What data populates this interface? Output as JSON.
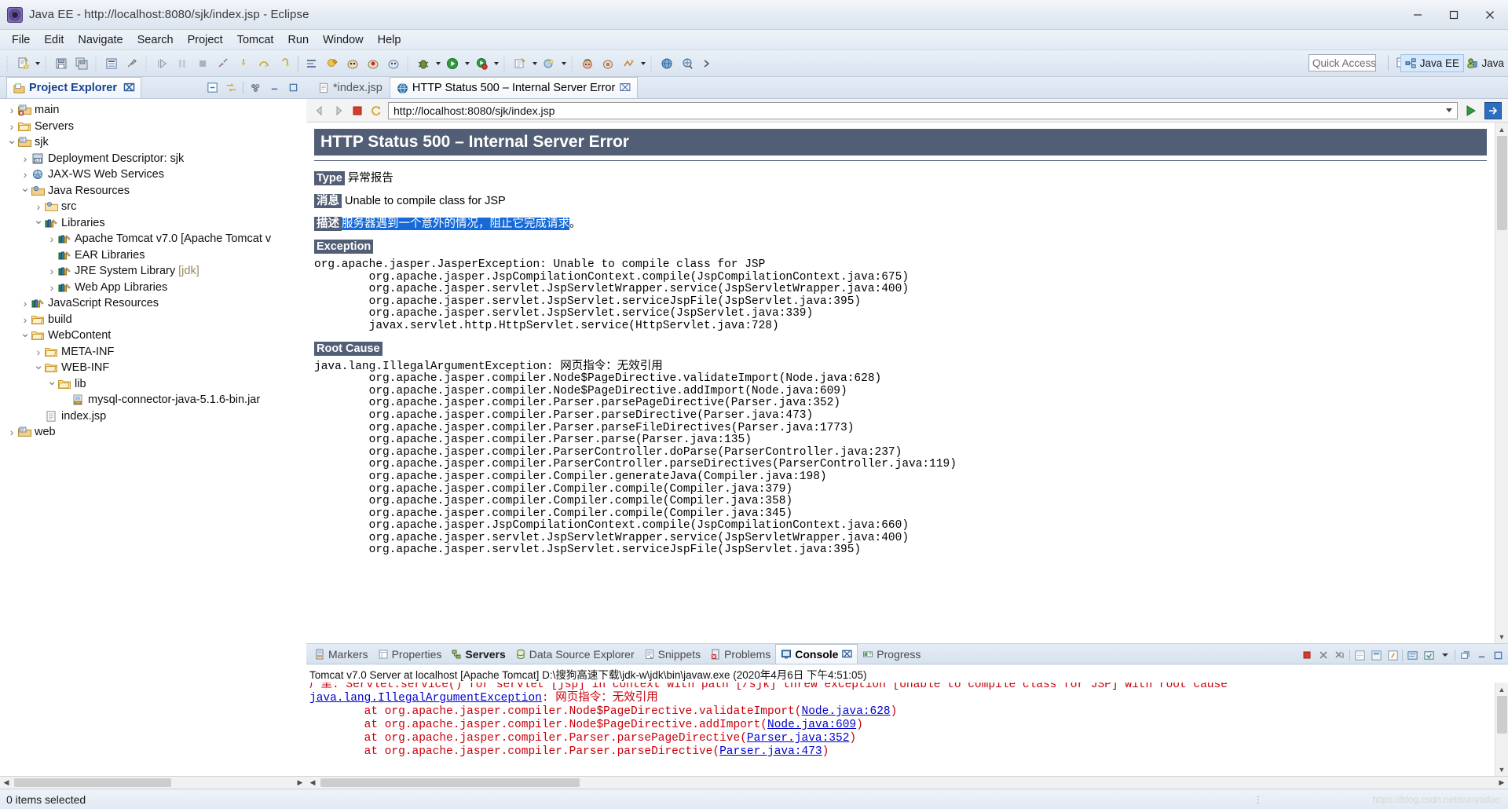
{
  "window": {
    "title": "Java EE - http://localhost:8080/sjk/index.jsp - Eclipse",
    "minimize": "─",
    "maximize": "❐",
    "close": "✕"
  },
  "menubar": {
    "items": [
      "File",
      "Edit",
      "Navigate",
      "Search",
      "Project",
      "Tomcat",
      "Run",
      "Window",
      "Help"
    ]
  },
  "toolbar": {
    "quick_access_placeholder": "Quick Access",
    "perspective_active": "Java EE",
    "perspective_other": "Java"
  },
  "project_explorer": {
    "title": "Project Explorer",
    "close_glyph": "⌧",
    "tree": [
      {
        "indent": 0,
        "twisty": "collapsed",
        "icon": "project-error-icon",
        "label": "main"
      },
      {
        "indent": 0,
        "twisty": "collapsed",
        "icon": "folder-icon",
        "label": "Servers"
      },
      {
        "indent": 0,
        "twisty": "expanded",
        "icon": "project-icon",
        "label": "sjk"
      },
      {
        "indent": 1,
        "twisty": "collapsed",
        "icon": "deployment-descriptor-icon",
        "label": "Deployment Descriptor: sjk"
      },
      {
        "indent": 1,
        "twisty": "collapsed",
        "icon": "jaxws-icon",
        "label": "JAX-WS Web Services"
      },
      {
        "indent": 1,
        "twisty": "expanded",
        "icon": "java-resources-icon",
        "label": "Java Resources"
      },
      {
        "indent": 2,
        "twisty": "collapsed",
        "icon": "source-folder-icon",
        "label": "src"
      },
      {
        "indent": 2,
        "twisty": "expanded",
        "icon": "library-icon",
        "label": "Libraries"
      },
      {
        "indent": 3,
        "twisty": "collapsed",
        "icon": "library-icon",
        "label": "Apache Tomcat v7.0 [Apache Tomcat v"
      },
      {
        "indent": 3,
        "twisty": "none",
        "icon": "library-icon",
        "label": "EAR Libraries"
      },
      {
        "indent": 3,
        "twisty": "collapsed",
        "icon": "library-icon",
        "label": "JRE System Library ",
        "dim": "[jdk]"
      },
      {
        "indent": 3,
        "twisty": "collapsed",
        "icon": "library-icon",
        "label": "Web App Libraries"
      },
      {
        "indent": 1,
        "twisty": "collapsed",
        "icon": "library-icon",
        "label": "JavaScript Resources"
      },
      {
        "indent": 1,
        "twisty": "collapsed",
        "icon": "folder-icon",
        "label": "build"
      },
      {
        "indent": 1,
        "twisty": "expanded",
        "icon": "folder-icon",
        "label": "WebContent"
      },
      {
        "indent": 2,
        "twisty": "collapsed",
        "icon": "folder-icon",
        "label": "META-INF"
      },
      {
        "indent": 2,
        "twisty": "expanded",
        "icon": "folder-icon",
        "label": "WEB-INF"
      },
      {
        "indent": 3,
        "twisty": "expanded",
        "icon": "folder-icon",
        "label": "lib"
      },
      {
        "indent": 4,
        "twisty": "none",
        "icon": "jar-icon",
        "label": "mysql-connector-java-5.1.6-bin.jar"
      },
      {
        "indent": 2,
        "twisty": "none",
        "icon": "jsp-file-icon",
        "label": "index.jsp"
      },
      {
        "indent": 0,
        "twisty": "collapsed",
        "icon": "project-icon",
        "label": "web"
      }
    ]
  },
  "editor": {
    "tabs": [
      {
        "label": "*index.jsp",
        "icon": "jsp-file-icon",
        "active": false,
        "closable": false
      },
      {
        "label": "HTTP Status 500 – Internal Server Error",
        "icon": "globe-icon",
        "active": true,
        "closable": true
      }
    ],
    "close_glyph": "⌧"
  },
  "browser": {
    "url": "http://localhost:8080/sjk/index.jsp",
    "back_icon": "back-arrow-icon",
    "forward_icon": "forward-arrow-icon",
    "stop_icon": "stop-icon",
    "refresh_icon": "refresh-icon",
    "go_icon": "run-icon",
    "page": {
      "heading": "HTTP Status 500 – Internal Server Error",
      "type_label": "Type",
      "type_value": "异常报告",
      "message_label": "消息",
      "message_value": "Unable to compile class for JSP",
      "description_label": "描述",
      "description_value": "服务器遇到一个意外的情况，阻止它完成请求",
      "description_tail": "。",
      "exception_label": "Exception",
      "exception_trace": "org.apache.jasper.JasperException: Unable to compile class for JSP\n        org.apache.jasper.JspCompilationContext.compile(JspCompilationContext.java:675)\n        org.apache.jasper.servlet.JspServletWrapper.service(JspServletWrapper.java:400)\n        org.apache.jasper.servlet.JspServlet.serviceJspFile(JspServlet.java:395)\n        org.apache.jasper.servlet.JspServlet.service(JspServlet.java:339)\n        javax.servlet.http.HttpServlet.service(HttpServlet.java:728)",
      "root_cause_label": "Root Cause",
      "root_cause_trace": "java.lang.IllegalArgumentException: 网页指令：无效引用\n        org.apache.jasper.compiler.Node$PageDirective.validateImport(Node.java:628)\n        org.apache.jasper.compiler.Node$PageDirective.addImport(Node.java:609)\n        org.apache.jasper.compiler.Parser.parsePageDirective(Parser.java:352)\n        org.apache.jasper.compiler.Parser.parseDirective(Parser.java:473)\n        org.apache.jasper.compiler.Parser.parseFileDirectives(Parser.java:1773)\n        org.apache.jasper.compiler.Parser.parse(Parser.java:135)\n        org.apache.jasper.compiler.ParserController.doParse(ParserController.java:237)\n        org.apache.jasper.compiler.ParserController.parseDirectives(ParserController.java:119)\n        org.apache.jasper.compiler.Compiler.generateJava(Compiler.java:198)\n        org.apache.jasper.compiler.Compiler.compile(Compiler.java:379)\n        org.apache.jasper.compiler.Compiler.compile(Compiler.java:358)\n        org.apache.jasper.compiler.Compiler.compile(Compiler.java:345)\n        org.apache.jasper.JspCompilationContext.compile(JspCompilationContext.java:660)\n        org.apache.jasper.servlet.JspServletWrapper.service(JspServletWrapper.java:400)\n        org.apache.jasper.servlet.JspServlet.serviceJspFile(JspServlet.java:395)"
    }
  },
  "console": {
    "tabs": [
      {
        "label": "Markers",
        "icon": "markers-icon",
        "active": false,
        "bold": false
      },
      {
        "label": "Properties",
        "icon": "properties-icon",
        "active": false,
        "bold": false
      },
      {
        "label": "Servers",
        "icon": "servers-icon",
        "active": false,
        "bold": true
      },
      {
        "label": "Data Source Explorer",
        "icon": "datasource-icon",
        "active": false,
        "bold": false
      },
      {
        "label": "Snippets",
        "icon": "snippets-icon",
        "active": false,
        "bold": false
      },
      {
        "label": "Problems",
        "icon": "problems-icon",
        "active": false,
        "bold": false
      },
      {
        "label": "Console",
        "icon": "console-icon",
        "active": true,
        "bold": true
      },
      {
        "label": "Progress",
        "icon": "progress-icon",
        "active": false,
        "bold": false
      }
    ],
    "close_glyph": "⌧",
    "header": "Tomcat v7.0 Server at localhost [Apache Tomcat] D:\\搜狗高速下载\\jdk-w\\jdk\\bin\\javaw.exe (2020年4月6日 下午4:51:05)",
    "lines": [
      {
        "text": "厂里: Servlet.service() for servlet [jsp] in context with path [/sjk] threw exception [Unable to compile class for JSP] with root cause",
        "style": "red-clipped"
      },
      {
        "text": "java.lang.IllegalArgumentException: 网页指令：无效引用",
        "style": "link-then-red"
      },
      {
        "text": "        at org.apache.jasper.compiler.Node$PageDirective.validateImport(Node.java:628)",
        "style": "red-with-link",
        "link": "Node.java:628"
      },
      {
        "text": "        at org.apache.jasper.compiler.Node$PageDirective.addImport(Node.java:609)",
        "style": "red-with-link",
        "link": "Node.java:609"
      },
      {
        "text": "        at org.apache.jasper.compiler.Parser.parsePageDirective(Parser.java:352)",
        "style": "red-with-link",
        "link": "Parser.java:352"
      },
      {
        "text": "        at org.apache.jasper.compiler.Parser.parseDirective(Parser.java:473)",
        "style": "red-with-link",
        "link": "Parser.java:473"
      }
    ]
  },
  "statusbar": {
    "text": "0 items selected",
    "watermark": "https://blog.csdn.net/sunyaduo"
  },
  "colors": {
    "tomcat_header_bg": "#525D76",
    "selection_blue": "#1669d8",
    "console_red": "#c8000a",
    "console_link": "#0000cc",
    "tab_label": "#15428b"
  }
}
